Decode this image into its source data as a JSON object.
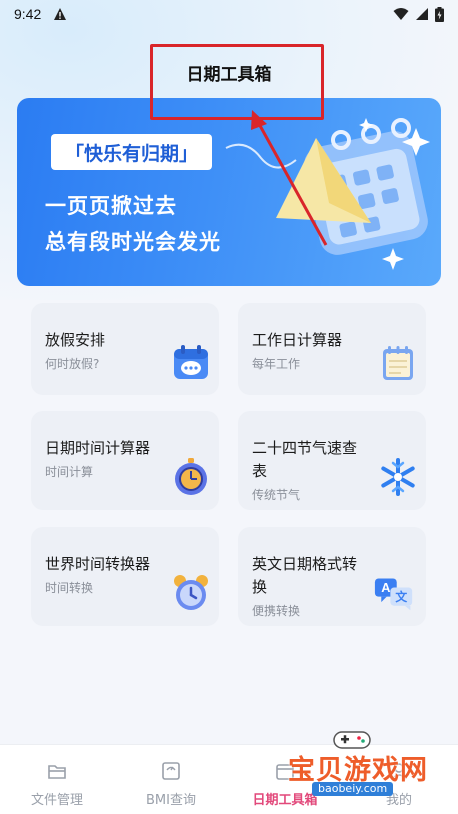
{
  "status": {
    "time": "9:42"
  },
  "header": {
    "title": "日期工具箱"
  },
  "banner": {
    "tag": "「快乐有归期」",
    "line1": "一页页掀过去",
    "line2": "总有段时光会发光"
  },
  "cards": [
    {
      "title": "放假安排",
      "sub": "何时放假?",
      "icon": "calendar-chat-icon"
    },
    {
      "title": "工作日计算器",
      "sub": "每年工作",
      "icon": "notepad-calendar-icon"
    },
    {
      "title": "日期时间计算器",
      "sub": "时间计算",
      "icon": "stopwatch-icon"
    },
    {
      "title": "二十四节气速查",
      "title2": "表",
      "sub": "传统节气",
      "icon": "snowflake-icon"
    },
    {
      "title": "世界时间转换器",
      "sub": "时间转换",
      "icon": "alarm-clock-icon"
    },
    {
      "title": "英文日期格式转",
      "title2": "换",
      "sub": "便携转换",
      "icon": "translate-icon"
    }
  ],
  "nav": {
    "items": [
      {
        "label": "文件管理",
        "icon": "folder-icon"
      },
      {
        "label": "BMI查询",
        "icon": "scale-icon"
      },
      {
        "label": "日期工具箱",
        "icon": "calendar-tool-icon"
      },
      {
        "label": "我的",
        "icon": "user-icon"
      }
    ]
  },
  "watermark": {
    "text": "宝贝游戏网",
    "url": "baobeiy.com"
  },
  "colors": {
    "accent": "#e2497b",
    "banner": "#3e8ff7",
    "annotation": "#d9252a"
  }
}
